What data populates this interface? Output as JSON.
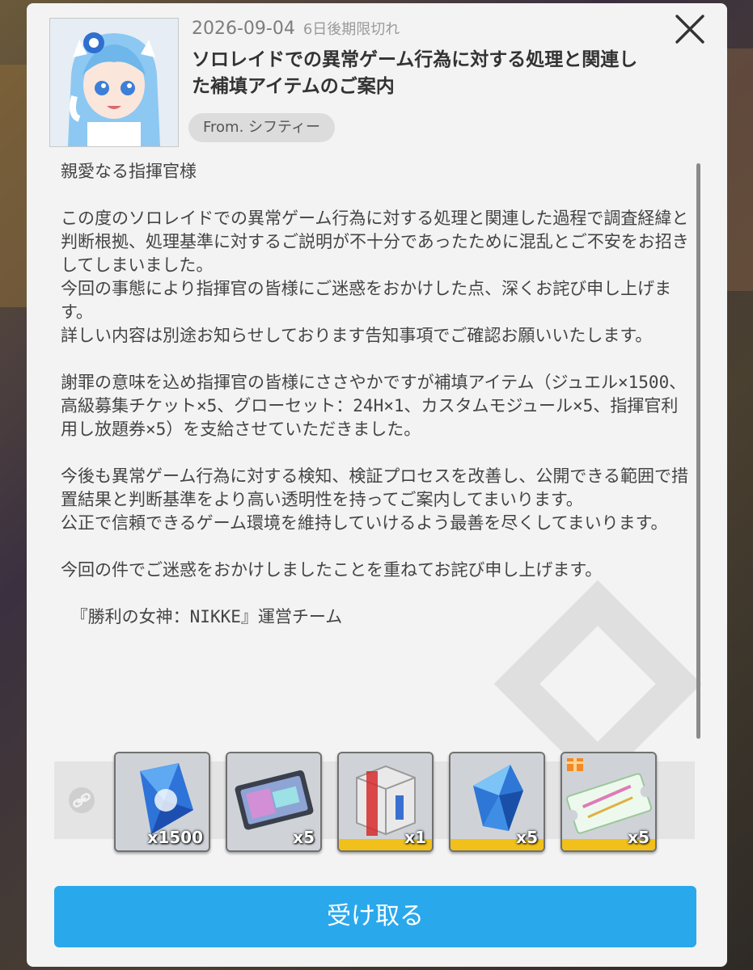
{
  "mail": {
    "date": "2026-09-04",
    "expiry": "6日後期限切れ",
    "title": "ソロレイドでの異常ゲーム行為に対する処理と関連した補填アイテムのご案内",
    "sender": "From. シフティー",
    "body": "親愛なる指揮官様\n\nこの度のソロレイドでの異常ゲーム行為に対する処理と関連した過程で調査経緯と判断根拠、処理基準に対するご説明が不十分であったために混乱とご不安をお招きしてしまいました。\n今回の事態により指揮官の皆様にご迷惑をおかけした点、深くお詫び申し上げます。\n詳しい内容は別途お知らせしております告知事項でご確認お願いいたします。\n\n謝罪の意味を込め指揮官の皆様にささやかですが補填アイテム（ジュエル×1500、高級募集チケット×5、グローセット：24H×1、カスタムモジュール×5、指揮官利用し放題券×5）を支給させていただきました。\n\n今後も異常ゲーム行為に対する検知、検証プロセスを改善し、公開できる範囲で措置結果と判断基準をより高い透明性を持ってご案内してまいります。\n公正で信頼できるゲーム環境を維持していけるよう最善を尽くしてまいります。\n\n今回の件でご迷惑をおかけしましたことを重ねてお詫び申し上げます。\n\n 『勝利の女神：NIKKE』運営チーム"
  },
  "rewards": [
    {
      "icon": "jewel-icon",
      "qty": "x1500",
      "rarity_bar": false
    },
    {
      "icon": "recruit-ticket-icon",
      "qty": "x5",
      "rarity_bar": false
    },
    {
      "icon": "glow-set-box-icon",
      "qty": "x1",
      "rarity_bar": true
    },
    {
      "icon": "custom-module-icon",
      "qty": "x5",
      "rarity_bar": true
    },
    {
      "icon": "unlimited-ticket-icon",
      "qty": "x5",
      "rarity_bar": true
    }
  ],
  "actions": {
    "claim_label": "受け取る"
  },
  "colors": {
    "accent": "#2aa8ec",
    "panel": "#f3f3f3",
    "rarity": "#f1c01a"
  }
}
